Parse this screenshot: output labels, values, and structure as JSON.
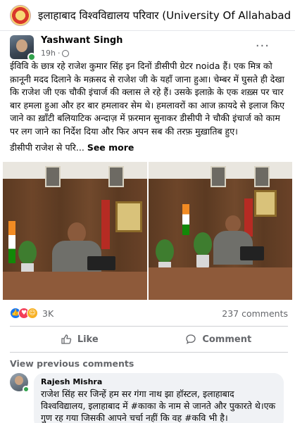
{
  "group": {
    "title": "इलाहाबाद विश्वविद्यालय परिवार (University Of Allahabad Family Group)"
  },
  "post": {
    "author": "Yashwant Singh",
    "time": "19h",
    "more_icon": "more-horizontal-icon",
    "text_para1": "ईविवि के छात्र रहे राजेश कुमार सिंह इन दिनों डीसीपी ग्रेटर noida हैं। एक मित्र को क़ानूनी मदद दिलाने के मक़सद से राजेश जी के यहाँ जाना हुआ। चेम्बर में घुसते ही देखा कि राजेश जी एक चौकी इंचार्ज की क्लास ले रहे हैं। उसके इलाक़े के एक शख़्स पर चार बार हमला हुआ और हर बार हमलावर सेम थे। हमलावरों का आज क़ायदे से इलाज किए जाने का ख़ाँटी बलियाटिक अन्दाज़ में फ़रमान सुनाकर डीसीपी ने चौकी इंचार्ज को काम पर लग जाने का निर्देश दिया और फिर अपन सब की तरफ़ मुख़ातिब हुए।",
    "text_para2": "डीसीपी राजेश से परि...",
    "see_more": "See more"
  },
  "reactions": {
    "icons": [
      "like-icon",
      "love-icon",
      "care-icon"
    ],
    "count": "3K",
    "comments_count": "237 comments"
  },
  "actions": {
    "like_label": "Like",
    "comment_label": "Comment"
  },
  "comments": {
    "view_previous": "View previous comments",
    "items": [
      {
        "name": "Rajesh Mishra",
        "text": "राजेश सिंह सर जिन्हें हम सर गंगा नाथ झा हॉस्टल, इलाहाबाद विश्वविद्यालय, इलाहाबाद में #काका के नाम से जानते और पुकारते थे।एक गुण रह गया जिसकी आपने चर्चा नहीं कि वह #कवि भी है।"
      }
    ]
  },
  "colors": {
    "like_blue": "#1877f2",
    "love_red": "#f33e58",
    "care_yellow": "#f7b125",
    "online_green": "#31a24c",
    "secondary_text": "#65676b"
  }
}
